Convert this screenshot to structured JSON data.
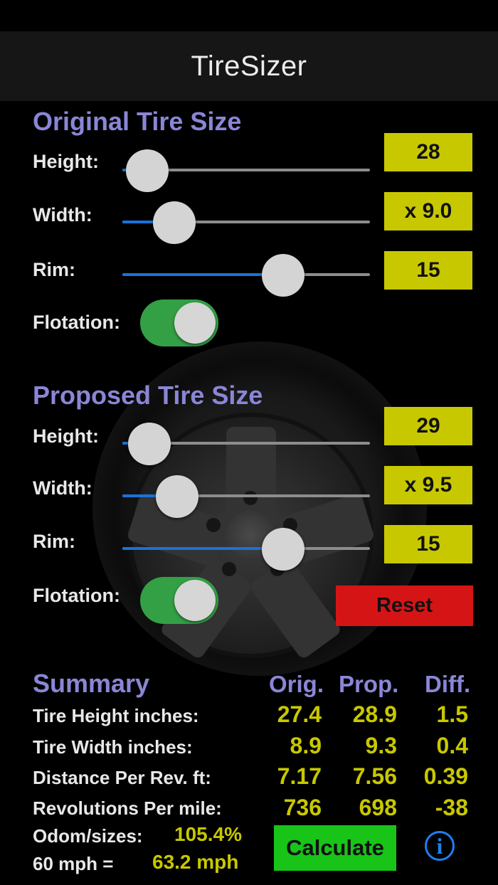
{
  "app": {
    "title": "TireSizer"
  },
  "original": {
    "section_title": "Original Tire Size",
    "height": {
      "label": "Height:",
      "value": "28",
      "slider": 0.1
    },
    "width": {
      "label": "Width:",
      "value": "x 9.0",
      "slider": 0.21
    },
    "rim": {
      "label": "Rim:",
      "value": "15",
      "slider": 0.65
    },
    "flotation": {
      "label": "Flotation:",
      "on": true
    }
  },
  "proposed": {
    "section_title": "Proposed Tire Size",
    "height": {
      "label": "Height:",
      "value": "29",
      "slider": 0.11
    },
    "width": {
      "label": "Width:",
      "value": "x 9.5",
      "slider": 0.22
    },
    "rim": {
      "label": "Rim:",
      "value": "15",
      "slider": 0.65
    },
    "flotation": {
      "label": "Flotation:",
      "on": true
    },
    "reset_label": "Reset"
  },
  "summary": {
    "title": "Summary",
    "headers": [
      "Orig.",
      "Prop.",
      "Diff."
    ],
    "rows": [
      {
        "label": "Tire Height  inches:",
        "orig": "27.4",
        "prop": "28.9",
        "diff": "1.5"
      },
      {
        "label": "Tire Width  inches:",
        "orig": "8.9",
        "prop": "9.3",
        "diff": "0.4"
      },
      {
        "label": "Distance Per Rev.  ft:",
        "orig": "7.17",
        "prop": "7.56",
        "diff": "0.39"
      },
      {
        "label": "Revolutions Per mile:",
        "orig": "736",
        "prop": "698",
        "diff": "-38"
      }
    ],
    "odom_label": "Odom/sizes:",
    "odom_value": "105.4%",
    "speed_label": "60 mph =",
    "speed_value": "63.2 mph",
    "calculate_label": "Calculate",
    "info_glyph": "i"
  },
  "colors": {
    "section_title": "#8a86d6",
    "value_box": "#c8c800",
    "reset": "#d51515",
    "calculate": "#18c418",
    "toggle_on": "#34a046",
    "slider_fill": "#1a72d9",
    "info": "#1e7ff0"
  }
}
